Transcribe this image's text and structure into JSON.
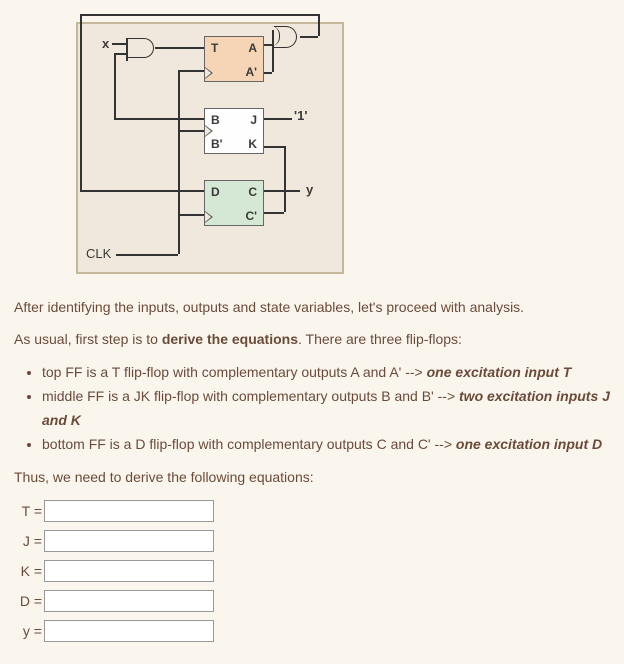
{
  "diagram": {
    "input_x": "x",
    "clk": "CLK",
    "ff_t": {
      "in": "T",
      "out": "A",
      "out_comp": "A'"
    },
    "ff_jk": {
      "in_j": "B",
      "in_j_lbl": "J",
      "in_k": "B'",
      "in_k_lbl": "K",
      "const": "'1'"
    },
    "ff_d": {
      "in": "D",
      "out": "C",
      "out_comp": "C'"
    },
    "output_y": "y"
  },
  "paragraphs": {
    "intro": "After identifying the inputs, outputs and state variables, let's proceed with analysis.",
    "step_prefix": "As usual, first step is to ",
    "step_bold": "derive the equations",
    "step_suffix": ". There are three flip-flops:",
    "thus": "Thus, we need to derive the following equations:"
  },
  "bullets": [
    {
      "text": "top FF is a T flip-flop with complementary outputs A and A' --> ",
      "em": "one excitation input T"
    },
    {
      "text": "middle FF is a JK flip-flop with complementary outputs B and B' --> ",
      "em": "two excitation inputs J and K"
    },
    {
      "text": "bottom FF is a D flip-flop with complementary outputs C and C' --> ",
      "em": "one excitation input D"
    }
  ],
  "equations": {
    "t": "T =",
    "j": "J =",
    "k": "K =",
    "d": "D =",
    "y": "y ="
  }
}
